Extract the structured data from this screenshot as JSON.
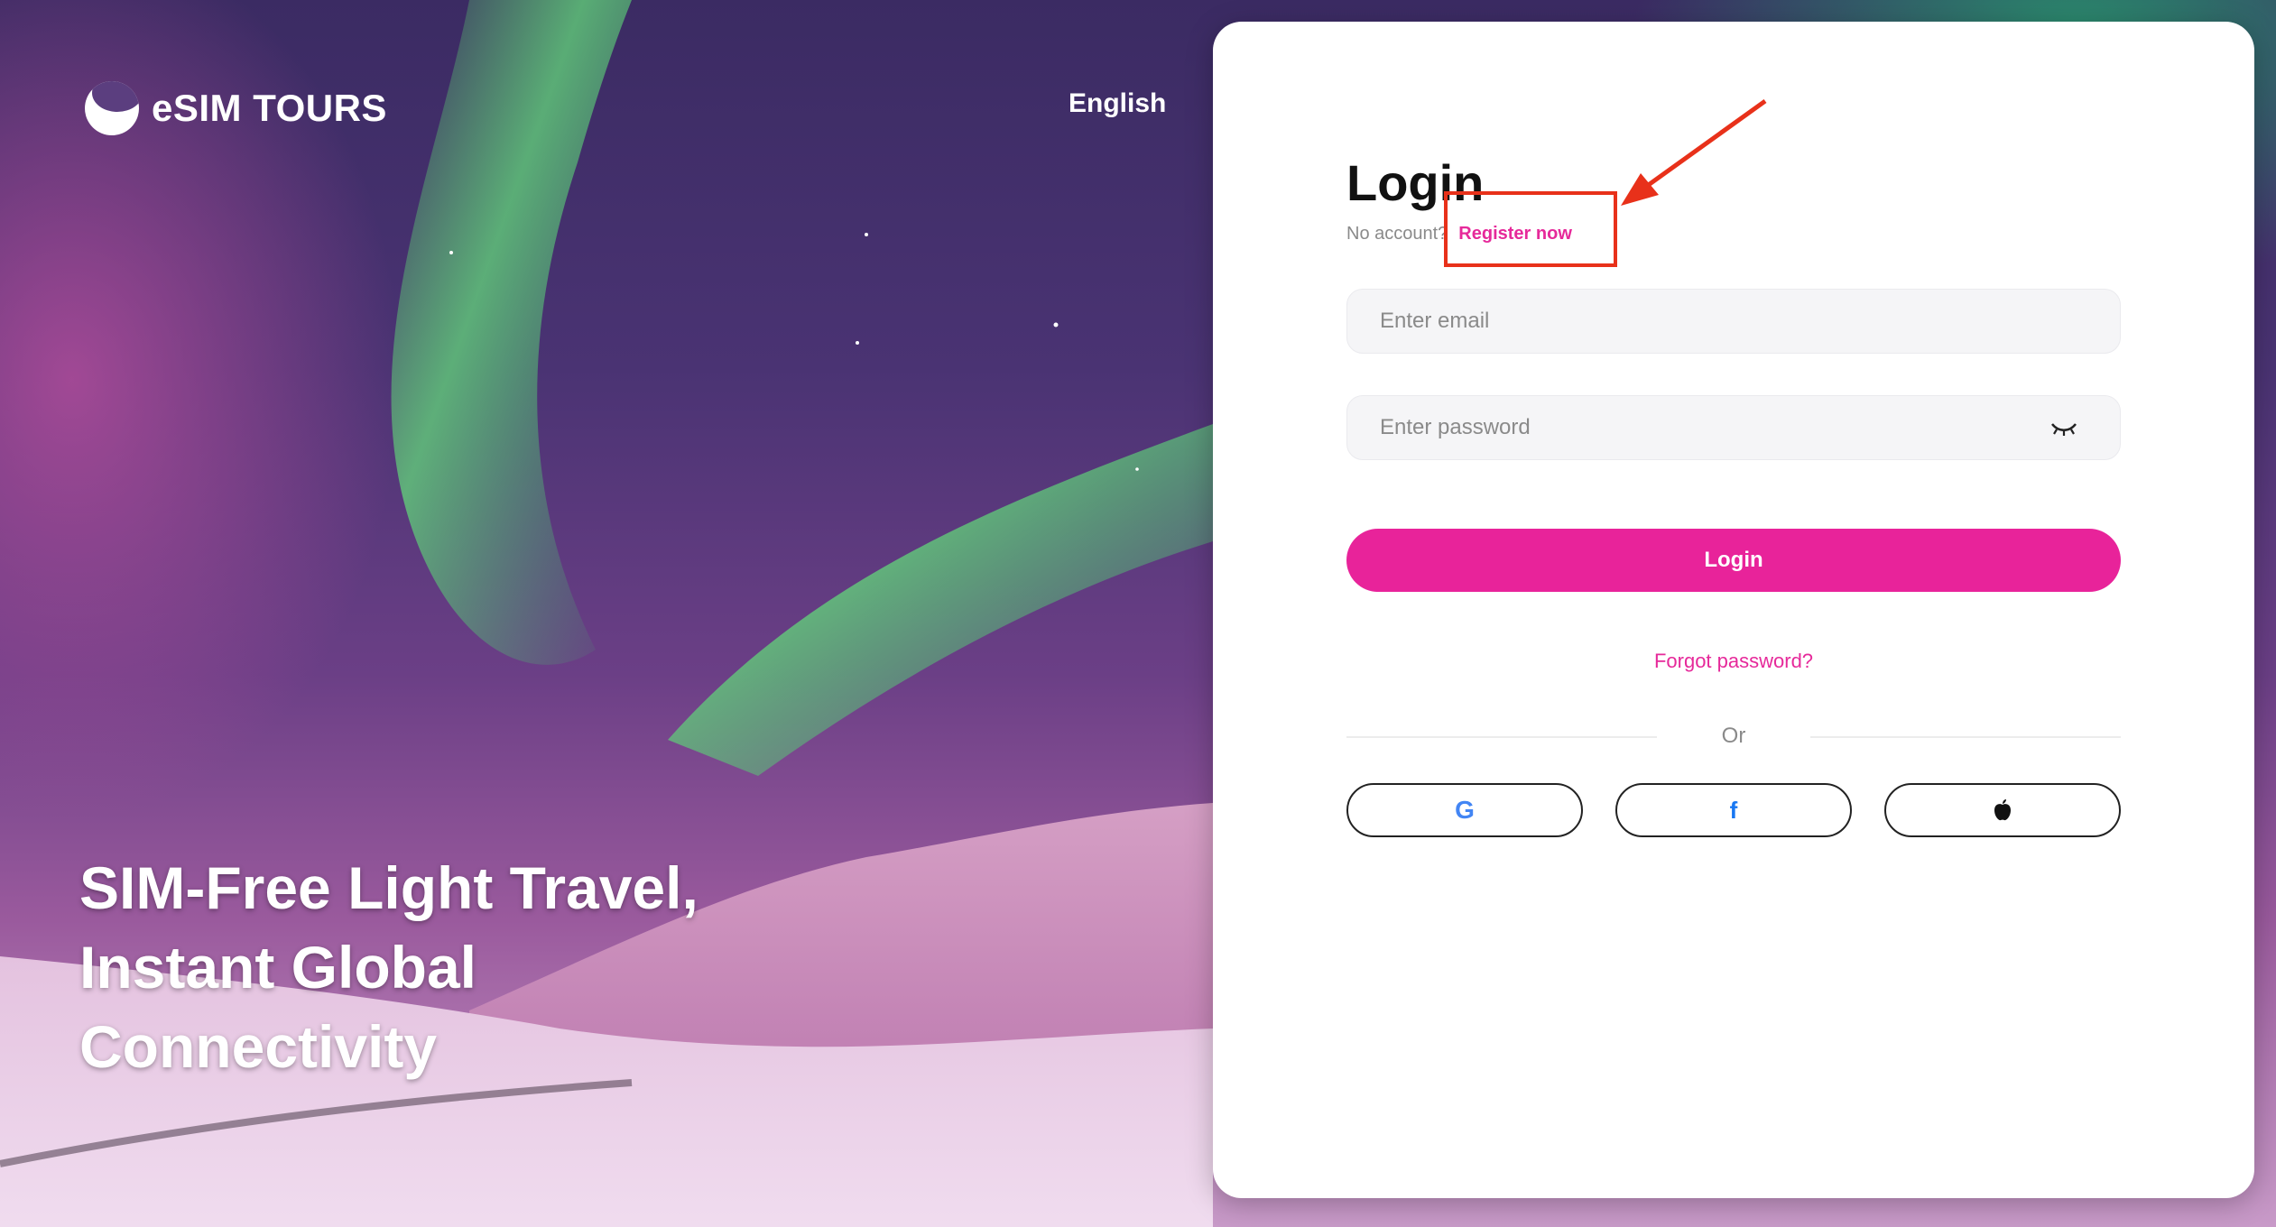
{
  "brand": {
    "name": "eSIM TOURS"
  },
  "header": {
    "language": "English"
  },
  "hero": {
    "lines": [
      "SIM-Free Light Travel,",
      "Instant Global",
      "Connectivity"
    ]
  },
  "login": {
    "title": "Login",
    "no_account_text": "No account?",
    "register_link": "Register now",
    "email_placeholder": "Enter email",
    "password_placeholder": "Enter password",
    "submit_label": "Login",
    "forgot_password": "Forgot password?",
    "divider_text": "Or",
    "social": [
      {
        "name": "google",
        "glyph": "G"
      },
      {
        "name": "facebook",
        "glyph": "f"
      },
      {
        "name": "apple",
        "glyph": ""
      }
    ]
  },
  "colors": {
    "accent": "#e8239a",
    "annotation": "#e8311a"
  }
}
